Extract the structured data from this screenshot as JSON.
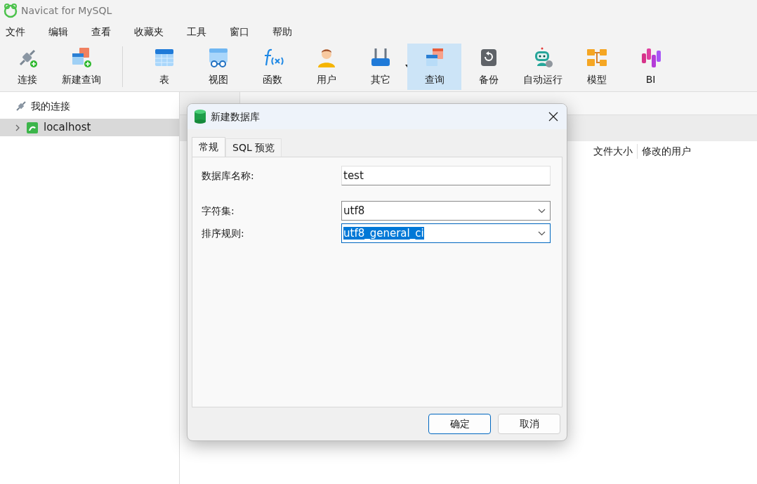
{
  "window": {
    "title": "Navicat for MySQL"
  },
  "menu": [
    "文件",
    "编辑",
    "查看",
    "收藏夹",
    "工具",
    "窗口",
    "帮助"
  ],
  "toolbar": [
    {
      "label": "连接",
      "selected": false,
      "dropdown": false
    },
    {
      "label": "新建查询",
      "selected": false,
      "dropdown": false
    },
    {
      "label": "表",
      "selected": false,
      "dropdown": false
    },
    {
      "label": "视图",
      "selected": false,
      "dropdown": false
    },
    {
      "label": "函数",
      "selected": false,
      "dropdown": false
    },
    {
      "label": "用户",
      "selected": false,
      "dropdown": false
    },
    {
      "label": "其它",
      "selected": false,
      "dropdown": true
    },
    {
      "label": "查询",
      "selected": true,
      "dropdown": false
    },
    {
      "label": "备份",
      "selected": false,
      "dropdown": false
    },
    {
      "label": "自动运行",
      "selected": false,
      "dropdown": false
    },
    {
      "label": "模型",
      "selected": false,
      "dropdown": false
    },
    {
      "label": "BI",
      "selected": false,
      "dropdown": false
    }
  ],
  "sidebar": {
    "header": "我的连接",
    "items": [
      {
        "label": "localhost",
        "selected": true,
        "expanded": false
      }
    ]
  },
  "main": {
    "columns": [
      "文件大小",
      "修改的用户"
    ]
  },
  "dialog": {
    "title": "新建数据库",
    "tabs": [
      {
        "label": "常规",
        "selected": true
      },
      {
        "label": "SQL 预览",
        "selected": false
      }
    ],
    "fields": [
      {
        "label": "数据库名称:",
        "kind": "text",
        "value": "test",
        "focused": false
      },
      {
        "label": "字符集:",
        "kind": "select",
        "value": "utf8",
        "focused": false
      },
      {
        "label": "排序规则:",
        "kind": "select",
        "value": "utf8_general_ci",
        "focused": true
      }
    ],
    "buttons": [
      {
        "label": "确定",
        "default": true
      },
      {
        "label": "取消",
        "default": false
      }
    ]
  }
}
